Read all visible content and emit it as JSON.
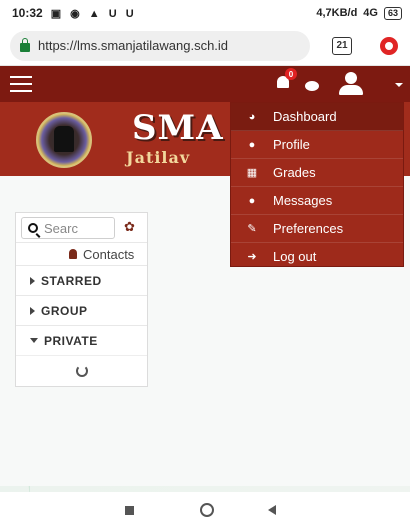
{
  "status_bar": {
    "time": "10:32",
    "left_icons": "▣ ◉ ▲ U U",
    "network": "4,7KB/d",
    "signal": "4G",
    "battery": "63"
  },
  "address_bar": {
    "url": "https://lms.smanjatilawang.sch.id",
    "tab_count": "21"
  },
  "navbar": {
    "notification_count": "0",
    "colors": {
      "navbar": "#7d1a11",
      "banner": "#a12c1c",
      "menu": "#9e2a1b"
    }
  },
  "banner": {
    "title": "SMA",
    "subtitle": "Jatilav"
  },
  "sidebar": {
    "search_placeholder": "Searc",
    "contacts_label": "Contacts",
    "sections": [
      {
        "label": "STARRED",
        "expanded": false
      },
      {
        "label": "GROUP",
        "expanded": false
      },
      {
        "label": "PRIVATE",
        "expanded": true
      }
    ]
  },
  "user_menu": {
    "items": [
      {
        "label": "Dashboard",
        "icon": "dashboard-icon",
        "active": true
      },
      {
        "label": "Profile",
        "icon": "user-icon",
        "active": false
      },
      {
        "label": "Grades",
        "icon": "table-icon",
        "active": false
      },
      {
        "label": "Messages",
        "icon": "chat-icon",
        "active": false
      },
      {
        "label": "Preferences",
        "icon": "wrench-icon",
        "active": false
      },
      {
        "label": "Log out",
        "icon": "logout-icon",
        "active": false
      }
    ]
  }
}
